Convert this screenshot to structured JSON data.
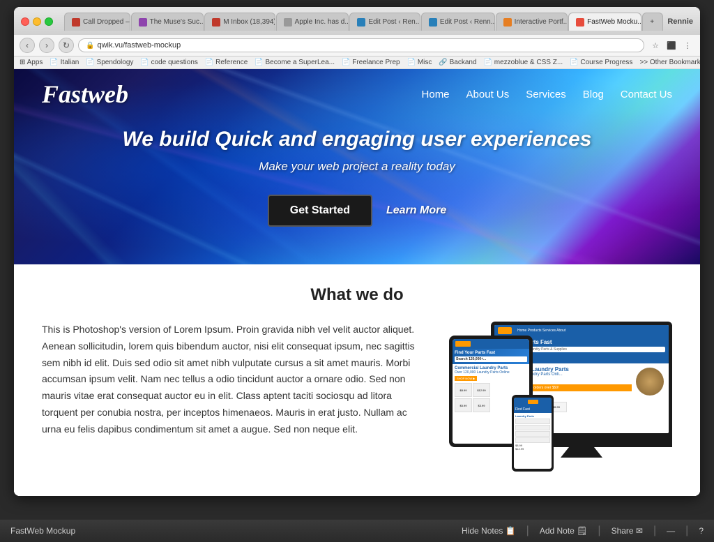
{
  "browser": {
    "tabs": [
      {
        "label": "Call Dropped –",
        "icon_color": "#c0392b",
        "active": false
      },
      {
        "label": "The Muse's Suc...",
        "icon_color": "#8e44ad",
        "active": false
      },
      {
        "label": "M Inbox (18,394)",
        "icon_color": "#c0392b",
        "active": false
      },
      {
        "label": "Apple Inc. has d...",
        "icon_color": "#999",
        "active": false
      },
      {
        "label": "Edit Post ‹ Ren...",
        "icon_color": "#2980b9",
        "active": false
      },
      {
        "label": "Edit Post ‹ Renn...",
        "icon_color": "#2980b9",
        "active": false
      },
      {
        "label": "Interactive Portf...",
        "icon_color": "#e67e22",
        "active": false
      },
      {
        "label": "FastWeb Mocku...",
        "icon_color": "#e74c3c",
        "active": true
      },
      {
        "label": "",
        "icon_color": "#999",
        "active": false
      }
    ],
    "user": "Rennie",
    "address": "qwik.vu/fastweb-mockup",
    "bookmarks": [
      "Apps",
      "Italian",
      "Spendology",
      "code questions",
      "Reference",
      "Become a SuperLea...",
      "Freelance Prep",
      "Misc",
      "Backand",
      "mezzoblue & CSS Z...",
      "Course Progress",
      "Other Bookmarks"
    ]
  },
  "site": {
    "logo": "Fastweb",
    "nav": {
      "links": [
        "Home",
        "About Us",
        "Services",
        "Blog",
        "Contact Us"
      ]
    },
    "hero": {
      "headline": "We build Quick and engaging user experiences",
      "subtext": "Make your web project a reality today",
      "cta_primary": "Get Started",
      "cta_secondary": "Learn More"
    },
    "what_we_do": {
      "title": "What we do",
      "body": "This is Photoshop's version  of Lorem Ipsum. Proin gravida nibh vel velit auctor aliquet. Aenean sollicitudin, lorem quis bibendum auctor, nisi elit consequat ipsum, nec sagittis sem nibh id elit. Duis sed odio sit amet nibh vulputate cursus a sit amet mauris. Morbi accumsan ipsum velit. Nam nec tellus a odio tincidunt auctor a ornare odio. Sed non  mauris vitae erat consequat auctor eu in elit. Class aptent taciti sociosqu ad litora torquent per conubia nostra, per inceptos himenaeos. Mauris in erat justo. Nullam ac urna eu felis dapibus condimentum sit amet a augue. Sed non neque elit."
    }
  },
  "bottom_bar": {
    "title": "FastWeb Mockup",
    "actions": [
      "Hide Notes",
      "Add Note",
      "Share",
      "—",
      "?"
    ]
  }
}
